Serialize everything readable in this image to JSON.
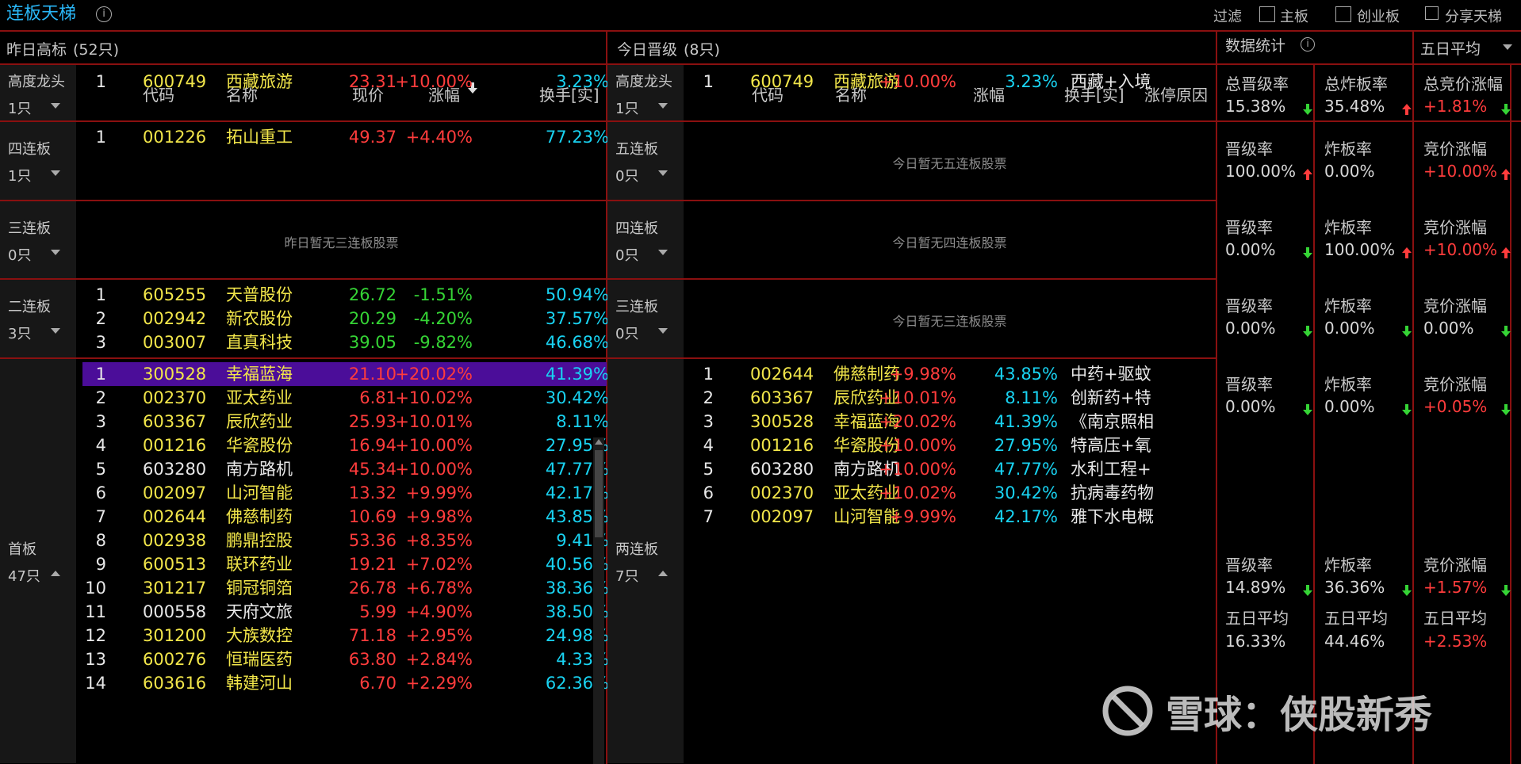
{
  "topbar": {
    "title": "连板天梯",
    "info_icon": "info-icon",
    "filter": "过滤",
    "cb1": "主板",
    "cb2": "创业板",
    "share": "分享天梯",
    "share_icon": "share-icon"
  },
  "left": {
    "title": "昨日高标",
    "count": "(52只)",
    "cols": [
      "代码",
      "名称",
      "现价",
      "涨幅",
      "换手[实]"
    ],
    "sort_icon": "sort-down-icon",
    "tiers": [
      {
        "name": "高度龙头",
        "count": "1只",
        "rows": [
          [
            "1",
            "600749",
            "西藏旅游",
            "23.31",
            "+10.00%",
            "3.23%"
          ]
        ]
      },
      {
        "name": "四连板",
        "count": "1只",
        "rows": [
          [
            "1",
            "001226",
            "拓山重工",
            "49.37",
            "+4.40%",
            "77.23%"
          ]
        ]
      },
      {
        "name": "三连板",
        "count": "0只",
        "empty": "昨日暂无三连板股票",
        "rows": []
      },
      {
        "name": "二连板",
        "count": "3只",
        "rows": [
          [
            "1",
            "605255",
            "天普股份",
            "26.72",
            "-1.51%",
            "50.94%"
          ],
          [
            "2",
            "002942",
            "新农股份",
            "20.29",
            "-4.20%",
            "37.57%"
          ],
          [
            "3",
            "003007",
            "直真科技",
            "39.05",
            "-9.82%",
            "46.68%"
          ]
        ]
      },
      {
        "name": "首板",
        "count": "47只",
        "rows": [
          [
            "1",
            "300528",
            "幸福蓝海",
            "21.10",
            "+20.02%",
            "41.39%"
          ],
          [
            "2",
            "002370",
            "亚太药业",
            "6.81",
            "+10.02%",
            "30.42%"
          ],
          [
            "3",
            "603367",
            "辰欣药业",
            "25.93",
            "+10.01%",
            "8.11%"
          ],
          [
            "4",
            "001216",
            "华瓷股份",
            "16.94",
            "+10.00%",
            "27.95%"
          ],
          [
            "5",
            "603280",
            "南方路机",
            "45.34",
            "+10.00%",
            "47.77%"
          ],
          [
            "6",
            "002097",
            "山河智能",
            "13.32",
            "+9.99%",
            "42.17%"
          ],
          [
            "7",
            "002644",
            "佛慈制药",
            "10.69",
            "+9.98%",
            "43.85%"
          ],
          [
            "8",
            "002938",
            "鹏鼎控股",
            "53.36",
            "+8.35%",
            "9.41%"
          ],
          [
            "9",
            "600513",
            "联环药业",
            "19.21",
            "+7.02%",
            "40.56%"
          ],
          [
            "10",
            "301217",
            "铜冠铜箔",
            "26.78",
            "+6.78%",
            "38.36%"
          ],
          [
            "11",
            "000558",
            "天府文旅",
            "5.99",
            "+4.90%",
            "38.50%"
          ],
          [
            "12",
            "301200",
            "大族数控",
            "71.18",
            "+2.95%",
            "24.98%"
          ],
          [
            "13",
            "600276",
            "恒瑞医药",
            "63.80",
            "+2.84%",
            "4.33%"
          ],
          [
            "14",
            "603616",
            "韩建河山",
            "6.70",
            "+2.29%",
            "62.36%"
          ]
        ]
      }
    ]
  },
  "mid": {
    "title": "今日晋级",
    "count": "(8只)",
    "cols": [
      "代码",
      "名称",
      "涨幅",
      "换手[实]",
      "涨停原因"
    ],
    "tiers": [
      {
        "name": "高度龙头",
        "count": "1只",
        "rows": [
          [
            "1",
            "600749",
            "西藏旅游",
            "+10.00%",
            "3.23%",
            "西藏+入境"
          ]
        ]
      },
      {
        "name": "五连板",
        "count": "0只",
        "empty": "今日暂无五连板股票",
        "rows": []
      },
      {
        "name": "四连板",
        "count": "0只",
        "empty": "今日暂无四连板股票",
        "rows": []
      },
      {
        "name": "三连板",
        "count": "0只",
        "empty": "今日暂无三连板股票",
        "rows": []
      },
      {
        "name": "两连板",
        "count": "7只",
        "rows": [
          [
            "1",
            "002644",
            "佛慈制药",
            "+9.98%",
            "43.85%",
            "中药+驱蚊"
          ],
          [
            "2",
            "603367",
            "辰欣药业",
            "+10.01%",
            "8.11%",
            "创新药+特"
          ],
          [
            "3",
            "300528",
            "幸福蓝海",
            "+20.02%",
            "41.39%",
            "《南京照相"
          ],
          [
            "4",
            "001216",
            "华瓷股份",
            "+10.00%",
            "27.95%",
            "特高压+氧"
          ],
          [
            "5",
            "603280",
            "南方路机",
            "+10.00%",
            "47.77%",
            "水利工程+"
          ],
          [
            "6",
            "002370",
            "亚太药业",
            "+10.02%",
            "30.42%",
            "抗病毒药物"
          ],
          [
            "7",
            "002097",
            "山河智能",
            "+9.99%",
            "42.17%",
            "雅下水电概"
          ]
        ]
      }
    ]
  },
  "right": {
    "title": "数据统计",
    "dropdown": "五日平均",
    "header": [
      [
        "总晋级率",
        "15.38%",
        "down"
      ],
      [
        "总炸板率",
        "35.48%",
        "up"
      ],
      [
        "总竞价涨幅",
        "+1.81%",
        "down"
      ]
    ],
    "rows": [
      [
        [
          "晋级率",
          "100.00%",
          "up"
        ],
        [
          "炸板率",
          "0.00%",
          ""
        ],
        [
          "竞价涨幅",
          "+10.00%",
          "up"
        ]
      ],
      [
        [
          "晋级率",
          "0.00%",
          "down"
        ],
        [
          "炸板率",
          "100.00%",
          "up"
        ],
        [
          "竞价涨幅",
          "+10.00%",
          "up"
        ]
      ],
      [
        [
          "晋级率",
          "0.00%",
          "down"
        ],
        [
          "炸板率",
          "0.00%",
          "down"
        ],
        [
          "竞价涨幅",
          "0.00%",
          "down"
        ]
      ],
      [
        [
          "晋级率",
          "0.00%",
          "down"
        ],
        [
          "炸板率",
          "0.00%",
          "down"
        ],
        [
          "竞价涨幅",
          "+0.05%",
          "down"
        ]
      ],
      [
        [
          "晋级率",
          "14.89%",
          "down"
        ],
        [
          "炸板率",
          "36.36%",
          "down"
        ],
        [
          "竞价涨幅",
          "+1.57%",
          "down"
        ]
      ]
    ],
    "avg": [
      [
        "五日平均",
        "16.33%"
      ],
      [
        "五日平均",
        "44.46%"
      ],
      [
        "五日平均",
        "+2.53%"
      ]
    ]
  },
  "watermark": {
    "text": "雪球：侠股新秀",
    "icon": "xueqiu-logo-icon"
  }
}
